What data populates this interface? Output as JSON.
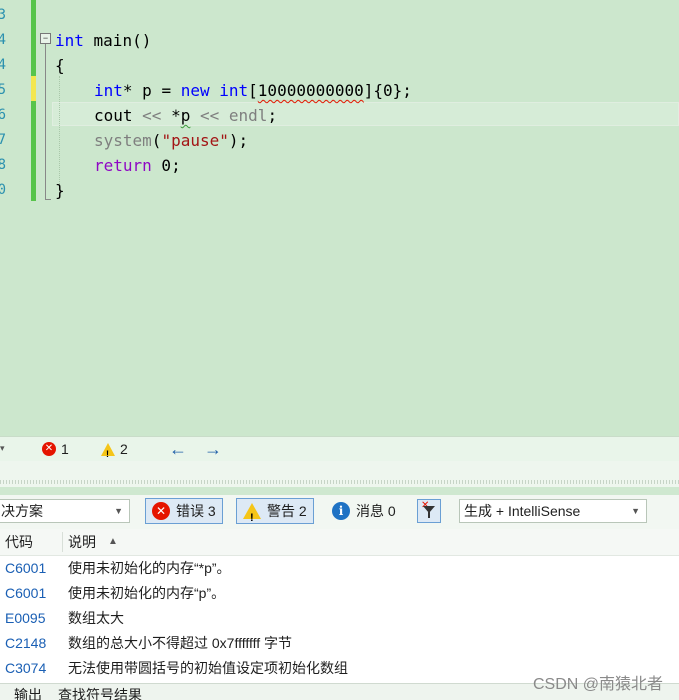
{
  "editor": {
    "line_numbers": [
      "3",
      "4",
      "5",
      "6",
      "7",
      "8",
      "9",
      "0"
    ],
    "fold_marker": "−",
    "lines": {
      "l4": {
        "kw": "int",
        "rest": " main()"
      },
      "l5": "{",
      "l6": {
        "kw1": "int",
        "p1": "* p = ",
        "kw2": "new",
        "sp": " ",
        "kw3": "int",
        "br": "[",
        "num": "10000000000",
        "tail": "]{0};"
      },
      "l7": {
        "a": "cout ",
        "op1": "<<",
        "b": " ",
        "star": "*",
        "p": "p",
        "c": " ",
        "op2": "<<",
        "d": " ",
        "endl": "endl",
        "e": ";"
      },
      "l8": {
        "fn": "system",
        "a": "(",
        "str": "\"pause\"",
        "b": ");"
      },
      "l9": {
        "kw": "return",
        "rest": " 0;"
      },
      "l10": "}"
    }
  },
  "status_strip": {
    "error_count": "1",
    "warning_count": "2",
    "back_arrow": "←",
    "forward_arrow": "→"
  },
  "error_list": {
    "scope_combo": "决方案",
    "errors_button": "错误 3",
    "warnings_button": "警告 2",
    "messages_button": "消息 0",
    "build_combo": "生成 + IntelliSense",
    "columns": {
      "code": "代码",
      "description": "说明",
      "sort_glyph": "▲"
    },
    "rows": [
      {
        "code": "C6001",
        "description": "使用未初始化的内存“*p”。"
      },
      {
        "code": "C6001",
        "description": "使用未初始化的内存“p”。"
      },
      {
        "code": "E0095",
        "description": "数组太大"
      },
      {
        "code": "C2148",
        "description": "数组的总大小不得超过 0x7fffffff 字节"
      },
      {
        "code": "C3074",
        "description": "无法使用带圆括号的初始值设定项初始化数组"
      }
    ]
  },
  "bottom_tabs": [
    "输出",
    "查找符号结果"
  ],
  "watermark": "CSDN @南猿北者",
  "colors": {
    "editor_bg": "#cce7cd",
    "keyword": "#0000ff",
    "error": "#e51400",
    "warning": "#f5c518",
    "code_link": "#1a5fb4"
  }
}
